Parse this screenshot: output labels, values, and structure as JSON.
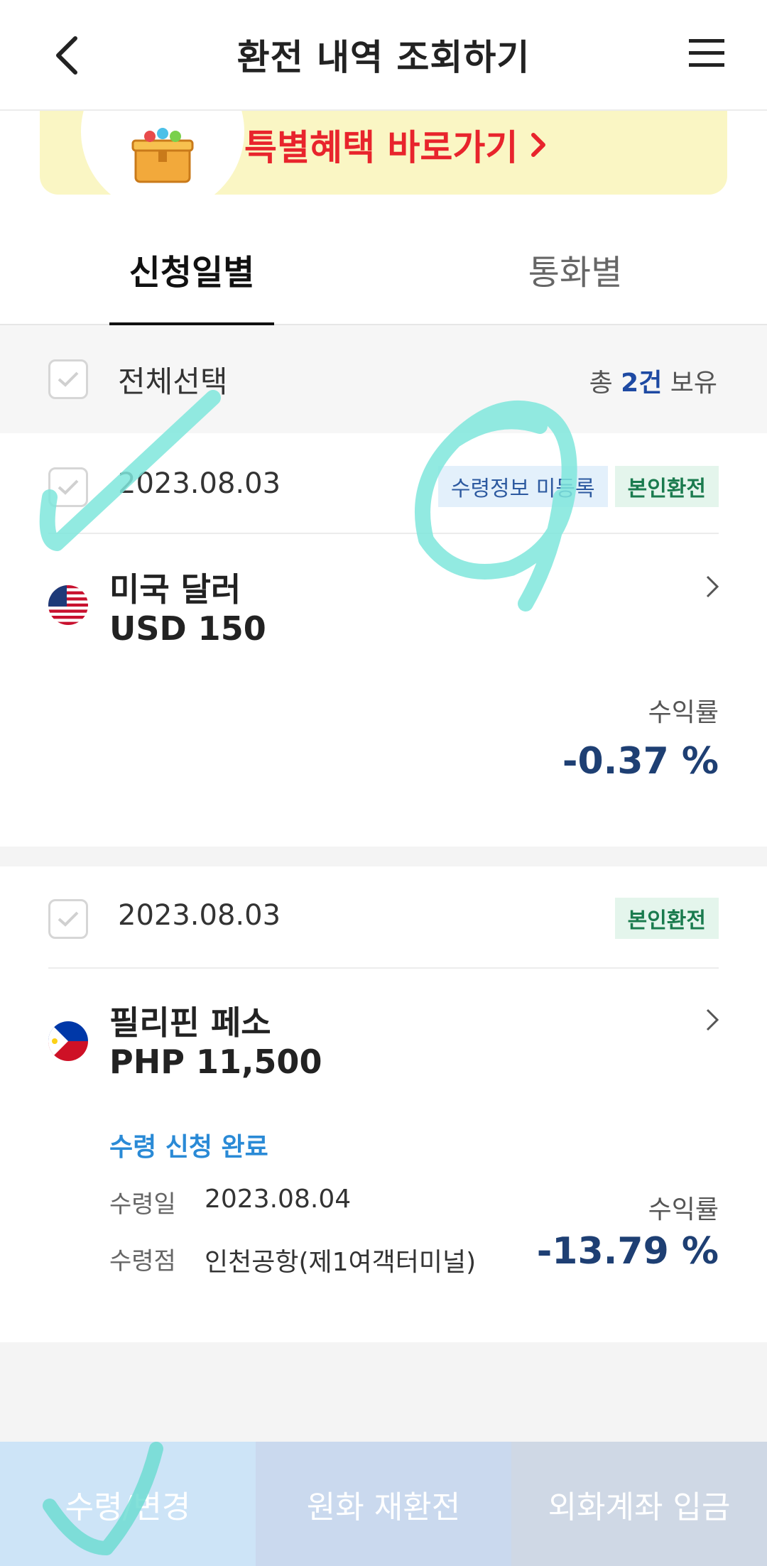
{
  "header": {
    "title": "환전 내역 조회하기",
    "back_icon": "chevron-left-icon",
    "menu_icon": "hamburger-menu-icon"
  },
  "banner": {
    "text": "특별혜택 바로가기",
    "arrow": "›",
    "icon": "treasure-chest-icon"
  },
  "tabs": [
    {
      "label": "신청일별",
      "active": true
    },
    {
      "label": "통화별",
      "active": false
    }
  ],
  "select_all": {
    "label": "전체선택",
    "count_prefix": "총 ",
    "count_num": "2건",
    "count_suffix": " 보유"
  },
  "items": [
    {
      "date": "2023.08.03",
      "badges": [
        "수령정보 미등록",
        "본인환전"
      ],
      "flag": "us-flag-icon",
      "currency_name": "미국 달러",
      "amount": "USD 150",
      "rate_label": "수익률",
      "rate_value": "-0.37 %"
    },
    {
      "date": "2023.08.03",
      "badges": [
        "본인환전"
      ],
      "flag": "ph-flag-icon",
      "currency_name": "필리핀 페소",
      "amount": "PHP 11,500",
      "status": "수령 신청 완료",
      "receipt_date_label": "수령일",
      "receipt_date": "2023.08.04",
      "receipt_place_label": "수령점",
      "receipt_place": "인천공항(제1여객터미널)",
      "rate_label": "수익률",
      "rate_value": "-13.79 %"
    }
  ],
  "bottom_bar": {
    "btn1": "수령/변경",
    "btn2": "원화 재환전",
    "btn3": "외화계좌 입금"
  },
  "colors": {
    "banner_bg": "#faf6c4",
    "banner_text": "#e8242c",
    "rate": "#1e3f73",
    "status": "#2a8ad6",
    "scribble": "#7fe6dc"
  }
}
